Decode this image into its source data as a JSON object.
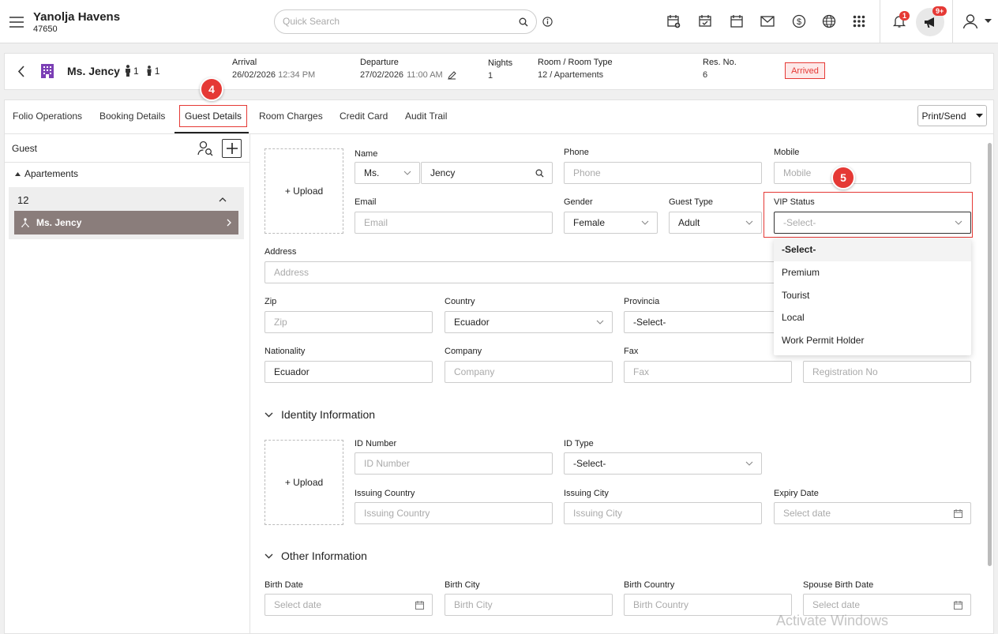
{
  "app": {
    "hotel_name": "Yanolja Havens",
    "hotel_code": "47650"
  },
  "topbar": {
    "search_placeholder": "Quick Search",
    "notification_count": "1",
    "announcement_count": "9+",
    "icons": [
      "menu-icon",
      "search-icon",
      "info-icon",
      "calendar-add-icon",
      "calendar-check-icon",
      "calendar-icon",
      "mail-icon",
      "dollar-icon",
      "globe-icon",
      "apps-grid-icon",
      "bell-icon",
      "megaphone-icon",
      "user-icon",
      "chevron-down-icon"
    ]
  },
  "reservation": {
    "guest_name": "Ms. Jency",
    "adults": "1",
    "children": "1",
    "arrival_label": "Arrival",
    "arrival_date": "26/02/2026",
    "arrival_time": "12:34 PM",
    "departure_label": "Departure",
    "departure_date": "27/02/2026",
    "departure_time": "11:00 AM",
    "nights_label": "Nights",
    "nights": "1",
    "room_label": "Room / Room Type",
    "room": "12 / Apartements",
    "resno_label": "Res. No.",
    "resno": "6",
    "status": "Arrived"
  },
  "tabs": [
    "Folio Operations",
    "Booking Details",
    "Guest Details",
    "Room Charges",
    "Credit Card",
    "Audit Trail"
  ],
  "active_tab": "Guest Details",
  "print_button": "Print/Send",
  "steps": {
    "tab_step": "4",
    "vip_step": "5"
  },
  "sidebar": {
    "title": "Guest",
    "room_type": "Apartements",
    "room_number": "12",
    "guest": "Ms. Jency"
  },
  "form": {
    "upload_label": "+ Upload",
    "name_label": "Name",
    "salutation": "Ms.",
    "first_name": "Jency",
    "phone_label": "Phone",
    "phone_placeholder": "Phone",
    "mobile_label": "Mobile",
    "mobile_placeholder": "Mobile",
    "email_label": "Email",
    "email_placeholder": "Email",
    "gender_label": "Gender",
    "gender": "Female",
    "guest_type_label": "Guest Type",
    "guest_type": "Adult",
    "vip_label": "VIP Status",
    "vip_value": "-Select-",
    "address_label": "Address",
    "address_placeholder": "Address",
    "zip_label": "Zip",
    "zip_placeholder": "Zip",
    "country_label": "Country",
    "country": "Ecuador",
    "provincia_label": "Provincia",
    "provincia": "-Select-",
    "nationality_label": "Nationality",
    "nationality": "Ecuador",
    "company_label": "Company",
    "company_placeholder": "Company",
    "fax_label": "Fax",
    "fax_placeholder": "Fax",
    "regno_placeholder": "Registration No"
  },
  "vip_options": [
    "-Select-",
    "Premium",
    "Tourist",
    "Local",
    "Work Permit Holder"
  ],
  "identity": {
    "title": "Identity Information",
    "upload_label": "+ Upload",
    "id_number_label": "ID Number",
    "id_number_placeholder": "ID Number",
    "id_type_label": "ID Type",
    "id_type": "-Select-",
    "issuing_country_label": "Issuing Country",
    "issuing_country_placeholder": "Issuing Country",
    "issuing_city_label": "Issuing City",
    "issuing_city_placeholder": "Issuing City",
    "expiry_label": "Expiry Date",
    "expiry_placeholder": "Select date"
  },
  "other": {
    "title": "Other Information",
    "birth_date_label": "Birth Date",
    "birth_date_placeholder": "Select date",
    "birth_city_label": "Birth City",
    "birth_city_placeholder": "Birth City",
    "birth_country_label": "Birth Country",
    "birth_country_placeholder": "Birth Country",
    "spouse_birth_label": "Spouse Birth Date",
    "spouse_birth_placeholder": "Select date"
  },
  "watermark": "Activate Windows",
  "colors": {
    "accent": "#e53935",
    "selected_guest_bg": "#8a7d7b",
    "hotel_icon": "#7b3fb5"
  }
}
